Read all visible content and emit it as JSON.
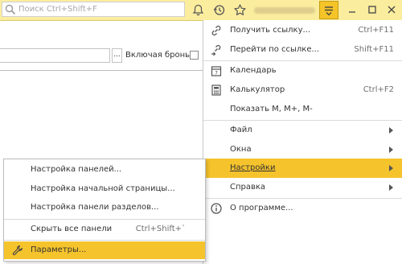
{
  "topbar": {
    "search_placeholder": "Поиск Ctrl+Shift+F",
    "bell_icon": "bell-icon",
    "history_icon": "history-icon",
    "star_icon": "star-icon",
    "menu_icon": "hamburger-menu-icon"
  },
  "form": {
    "field_button": "...",
    "reservation_label": "Включая бронь:"
  },
  "menu": {
    "items": [
      {
        "label": "Получить ссылку...",
        "shortcut": "Ctrl+F11",
        "icon": "link-icon"
      },
      {
        "label": "Перейти по ссылке...",
        "shortcut": "Shift+F11",
        "icon": "goto-link-icon"
      },
      {
        "label": "Календарь",
        "icon": "calendar-icon"
      },
      {
        "label": "Калькулятор",
        "shortcut": "Ctrl+F2",
        "icon": "calculator-icon"
      },
      {
        "label": "Показать М, М+, М-"
      },
      {
        "label": "Файл"
      },
      {
        "label": "Окна"
      },
      {
        "label": "Настройки"
      },
      {
        "label": "Справка"
      },
      {
        "label": "О программе...",
        "icon": "info-icon"
      }
    ]
  },
  "submenu": {
    "items": [
      {
        "label": "Настройка панелей..."
      },
      {
        "label": "Настройка начальной страницы..."
      },
      {
        "label": "Настройка панели разделов..."
      },
      {
        "label": "Скрыть все панели",
        "shortcut": "Ctrl+Shift+`"
      },
      {
        "label": "Параметры...",
        "icon": "wrench-icon"
      }
    ]
  },
  "colors": {
    "topbar_bg": "#fbed9e",
    "highlight": "#f5c32c"
  }
}
